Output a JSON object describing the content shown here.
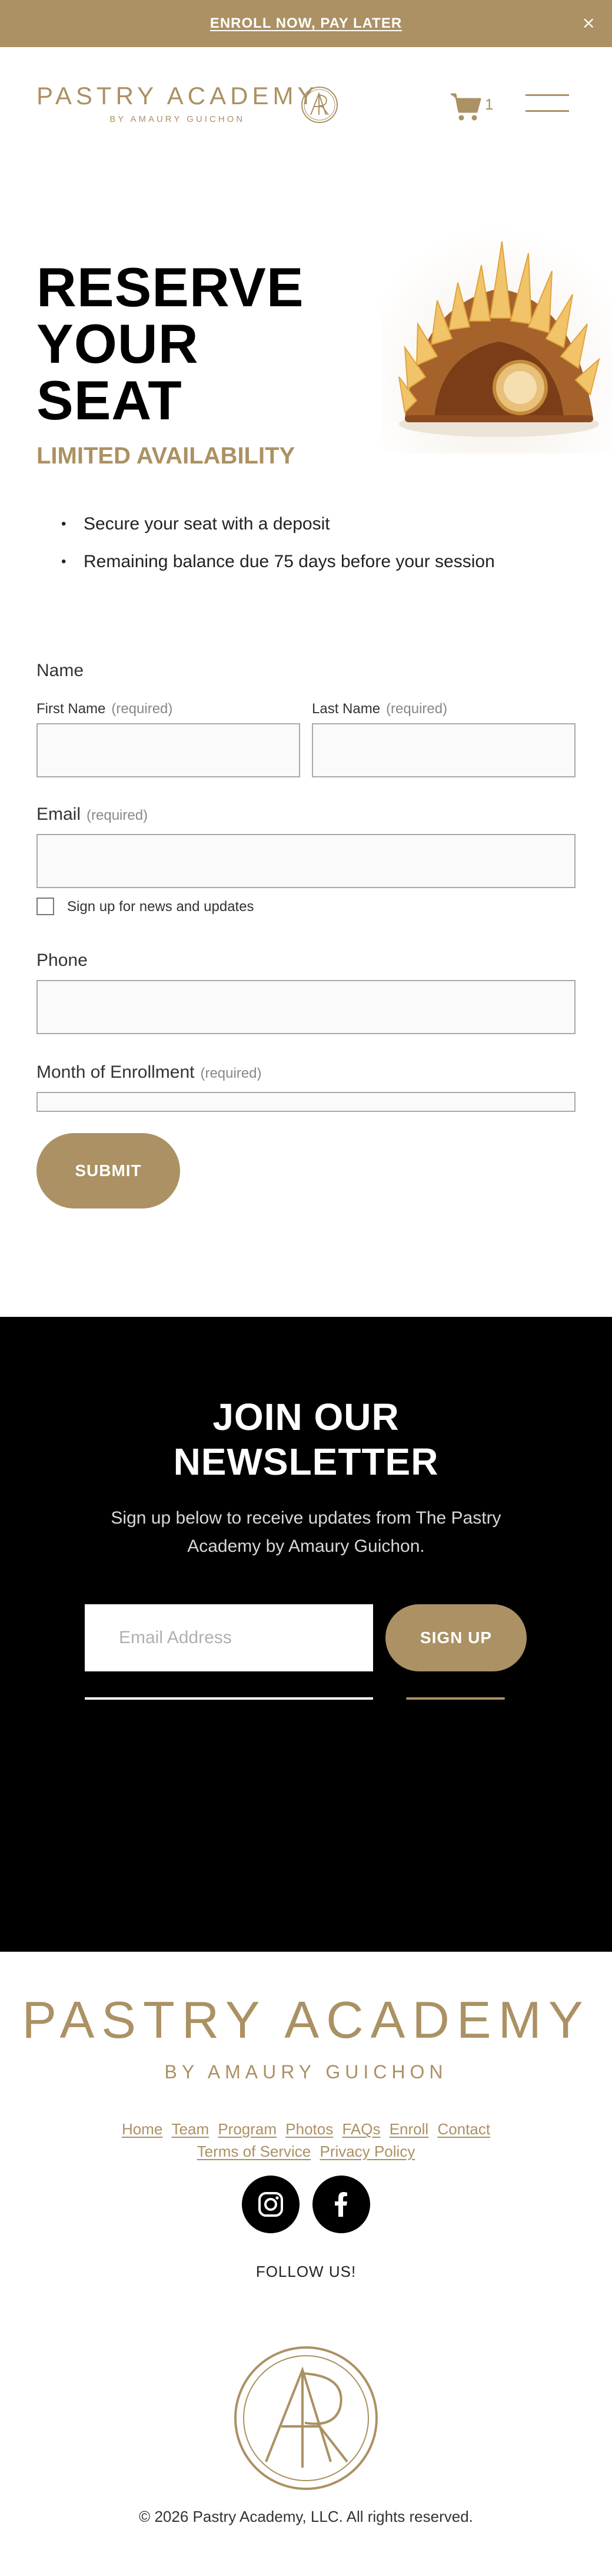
{
  "announcement": {
    "text": "ENROLL NOW, PAY LATER",
    "close_glyph": "×"
  },
  "header": {
    "logo_main": "PASTRY ACADEMY",
    "logo_sub": "BY AMAURY GUICHON",
    "cart_count": "1",
    "icons": [
      "logo-monogram-icon",
      "cart-icon",
      "menu-icon"
    ]
  },
  "hero": {
    "title_lines": [
      "RESERVE",
      "YOUR",
      "SEAT"
    ],
    "subtitle": "LIMITED AVAILABILITY",
    "bullets": [
      "Secure your seat with a deposit",
      "Remaining balance due 75 days before your session"
    ]
  },
  "form": {
    "name_label": "Name",
    "first_name_label": "First Name",
    "last_name_label": "Last Name",
    "required": "(required)",
    "email_label": "Email",
    "newsletter_checkbox_label": "Sign up for news and updates",
    "phone_label": "Phone",
    "month_label": "Month of Enrollment",
    "submit_label": "SUBMIT"
  },
  "newsletter": {
    "title_line1": "JOIN OUR",
    "title_line2": "NEWSLETTER",
    "description": "Sign up below to receive updates from The Pastry Academy by Amaury Guichon.",
    "email_placeholder": "Email Address",
    "button_label": "SIGN UP"
  },
  "footer": {
    "logo_main": "PASTRY ACADEMY",
    "logo_sub": "BY AMAURY GUICHON",
    "links": [
      "Home",
      "Team",
      "Program",
      "Photos",
      "FAQs",
      "Enroll",
      "Contact",
      "Terms of Service",
      "Privacy Policy"
    ],
    "social": [
      "instagram-icon",
      "facebook-icon"
    ],
    "follow": "FOLLOW US!",
    "copyright": "© 2026 Pastry Academy, LLC. All rights reserved."
  },
  "colors": {
    "gold": "#ab9163",
    "black": "#000000",
    "white": "#ffffff"
  }
}
